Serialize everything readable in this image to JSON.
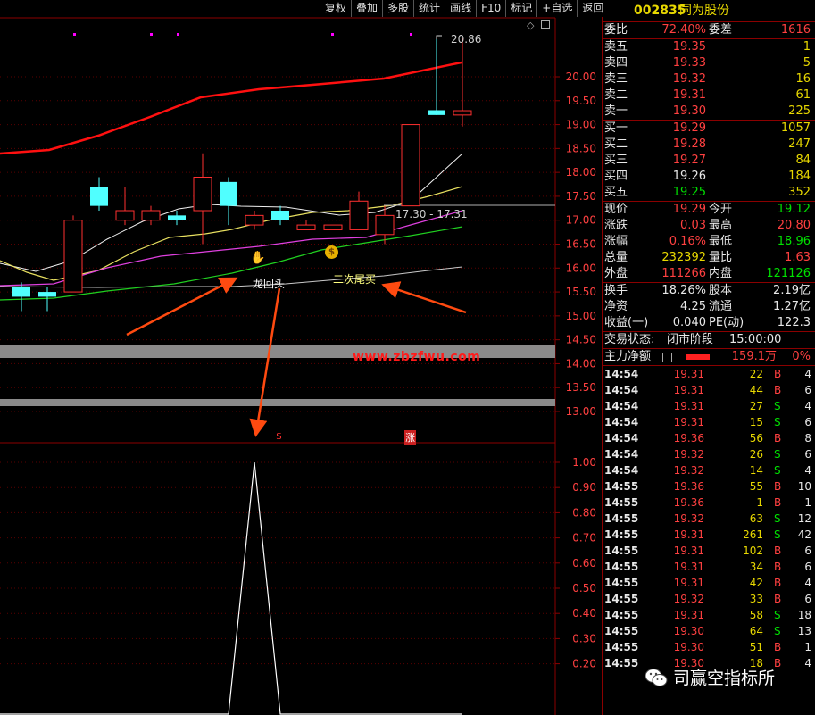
{
  "toolbar": [
    "复权",
    "叠加",
    "多股",
    "统计",
    "画线",
    "F10",
    "标记",
    "+自选",
    "返回"
  ],
  "chart": {
    "hi_label": "20.86",
    "range_label": "17.30 - 17.31",
    "ann1": "龙回头",
    "ann2": "二次尾买",
    "site": "www.zbzfwu.com",
    "mark_s": "$",
    "mark_zhang": "涨",
    "money_icon": "money-bag-icon",
    "price_ticks": [
      "20.00",
      "19.50",
      "19.00",
      "18.50",
      "18.00",
      "17.50",
      "17.00",
      "16.50",
      "16.00",
      "15.50",
      "15.00",
      "14.50",
      "14.00",
      "13.50",
      "13.00"
    ],
    "ind_ticks": [
      "1.00",
      "0.90",
      "0.80",
      "0.70",
      "0.60",
      "0.50",
      "0.40",
      "0.30",
      "0.20"
    ]
  },
  "chart_data": {
    "type": "candlestick",
    "candles": [
      {
        "o": 15.6,
        "c": 15.4,
        "h": 15.7,
        "l": 15.1
      },
      {
        "o": 15.5,
        "c": 15.4,
        "h": 15.6,
        "l": 15.1
      },
      {
        "o": 15.5,
        "c": 17.0,
        "h": 17.1,
        "l": 15.5
      },
      {
        "o": 17.7,
        "c": 17.3,
        "h": 17.9,
        "l": 17.2
      },
      {
        "o": 17.0,
        "c": 17.2,
        "h": 17.7,
        "l": 16.9
      },
      {
        "o": 17.0,
        "c": 17.2,
        "h": 17.3,
        "l": 16.9
      },
      {
        "o": 17.1,
        "c": 17.0,
        "h": 17.2,
        "l": 16.9
      },
      {
        "o": 17.2,
        "c": 17.9,
        "h": 18.4,
        "l": 16.5
      },
      {
        "o": 17.8,
        "c": 17.3,
        "h": 17.9,
        "l": 16.9
      },
      {
        "o": 16.9,
        "c": 17.1,
        "h": 17.2,
        "l": 16.8
      },
      {
        "o": 17.2,
        "c": 17.0,
        "h": 17.3,
        "l": 16.9
      },
      {
        "o": 16.8,
        "c": 16.9,
        "h": 17.0,
        "l": 16.8
      },
      {
        "o": 16.8,
        "c": 16.9,
        "h": 16.9,
        "l": 16.8
      },
      {
        "o": 16.8,
        "c": 17.4,
        "h": 17.6,
        "l": 16.8
      },
      {
        "o": 16.7,
        "c": 17.1,
        "h": 17.3,
        "l": 16.5
      },
      {
        "o": 17.3,
        "c": 19.0,
        "h": 19.0,
        "l": 17.3
      },
      {
        "o": 19.3,
        "c": 19.2,
        "h": 20.86,
        "l": 19.2
      },
      {
        "o": 19.2,
        "c": 19.29,
        "h": 20.8,
        "l": 18.96
      }
    ],
    "indicator": [
      0,
      0,
      0,
      0,
      0,
      0,
      0,
      0,
      0,
      1,
      0,
      0,
      0,
      0,
      0,
      0,
      0,
      0
    ],
    "y_range": [
      13.0,
      20.0
    ],
    "ind_range": [
      0,
      1
    ]
  },
  "quote": {
    "code": "002835",
    "name": "同为股份",
    "wb_label": "委比",
    "wb": "72.40%",
    "wc_label": "委差",
    "wc": "1616",
    "asks": [
      {
        "label": "卖五",
        "price": "19.35",
        "vol": "1"
      },
      {
        "label": "卖四",
        "price": "19.33",
        "vol": "5"
      },
      {
        "label": "卖三",
        "price": "19.32",
        "vol": "16"
      },
      {
        "label": "卖二",
        "price": "19.31",
        "vol": "61"
      },
      {
        "label": "卖一",
        "price": "19.30",
        "vol": "225"
      }
    ],
    "bids": [
      {
        "label": "买一",
        "price": "19.29",
        "vol": "1057"
      },
      {
        "label": "买二",
        "price": "19.28",
        "vol": "247"
      },
      {
        "label": "买三",
        "price": "19.27",
        "vol": "84"
      },
      {
        "label": "买四",
        "price": "19.26",
        "vol": "184"
      },
      {
        "label": "买五",
        "price": "19.25",
        "vol": "352"
      }
    ],
    "stats": [
      {
        "l1": "现价",
        "v1": "19.29",
        "c1": "red",
        "l2": "今开",
        "v2": "19.12",
        "c2": "green"
      },
      {
        "l1": "涨跌",
        "v1": "0.03",
        "c1": "red",
        "l2": "最高",
        "v2": "20.80",
        "c2": "red"
      },
      {
        "l1": "涨幅",
        "v1": "0.16%",
        "c1": "red",
        "l2": "最低",
        "v2": "18.96",
        "c2": "green"
      },
      {
        "l1": "总量",
        "v1": "232392",
        "c1": "yellow",
        "l2": "量比",
        "v2": "1.63",
        "c2": "red"
      },
      {
        "l1": "外盘",
        "v1": "111266",
        "c1": "red",
        "l2": "内盘",
        "v2": "121126",
        "c2": "green"
      }
    ],
    "stats2": [
      {
        "l1": "换手",
        "v1": "18.26%",
        "l2": "股本",
        "v2": "2.19亿"
      },
      {
        "l1": "净资",
        "v1": "4.25",
        "l2": "流通",
        "v2": "1.27亿"
      },
      {
        "l1": "收益(一)",
        "v1": "0.040",
        "l2": "PE(动)",
        "v2": "122.3"
      }
    ],
    "trade_state_label": "交易状态:",
    "trade_state": "闭市阶段",
    "trade_time": "15:00:00",
    "main_flow_label": "主力净额",
    "main_flow": "159.1万",
    "main_flow_pct": "0%"
  },
  "ticks": [
    {
      "t": "14:54",
      "p": "19.31",
      "v": "22",
      "s": "B",
      "n": "4"
    },
    {
      "t": "14:54",
      "p": "19.31",
      "v": "44",
      "s": "B",
      "n": "6"
    },
    {
      "t": "14:54",
      "p": "19.31",
      "v": "27",
      "s": "S",
      "n": "4"
    },
    {
      "t": "14:54",
      "p": "19.31",
      "v": "15",
      "s": "S",
      "n": "6"
    },
    {
      "t": "14:54",
      "p": "19.36",
      "v": "56",
      "s": "B",
      "n": "8"
    },
    {
      "t": "14:54",
      "p": "19.32",
      "v": "26",
      "s": "S",
      "n": "6"
    },
    {
      "t": "14:54",
      "p": "19.32",
      "v": "14",
      "s": "S",
      "n": "4"
    },
    {
      "t": "14:55",
      "p": "19.36",
      "v": "55",
      "s": "B",
      "n": "10"
    },
    {
      "t": "14:55",
      "p": "19.36",
      "v": "1",
      "s": "B",
      "n": "1"
    },
    {
      "t": "14:55",
      "p": "19.32",
      "v": "63",
      "s": "S",
      "n": "12"
    },
    {
      "t": "14:55",
      "p": "19.31",
      "v": "261",
      "s": "S",
      "n": "42"
    },
    {
      "t": "14:55",
      "p": "19.31",
      "v": "102",
      "s": "B",
      "n": "6"
    },
    {
      "t": "14:55",
      "p": "19.31",
      "v": "34",
      "s": "B",
      "n": "6"
    },
    {
      "t": "14:55",
      "p": "19.31",
      "v": "42",
      "s": "B",
      "n": "4"
    },
    {
      "t": "14:55",
      "p": "19.32",
      "v": "33",
      "s": "B",
      "n": "6"
    },
    {
      "t": "14:55",
      "p": "19.31",
      "v": "58",
      "s": "S",
      "n": "18"
    },
    {
      "t": "14:55",
      "p": "19.30",
      "v": "64",
      "s": "S",
      "n": "13"
    },
    {
      "t": "14:55",
      "p": "19.30",
      "v": "51",
      "s": "B",
      "n": "1"
    },
    {
      "t": "14:55",
      "p": "19.30",
      "v": "18",
      "s": "B",
      "n": "4"
    }
  ],
  "watermark": {
    "text": "司赢空指标所",
    "icon": "wechat-icon"
  }
}
